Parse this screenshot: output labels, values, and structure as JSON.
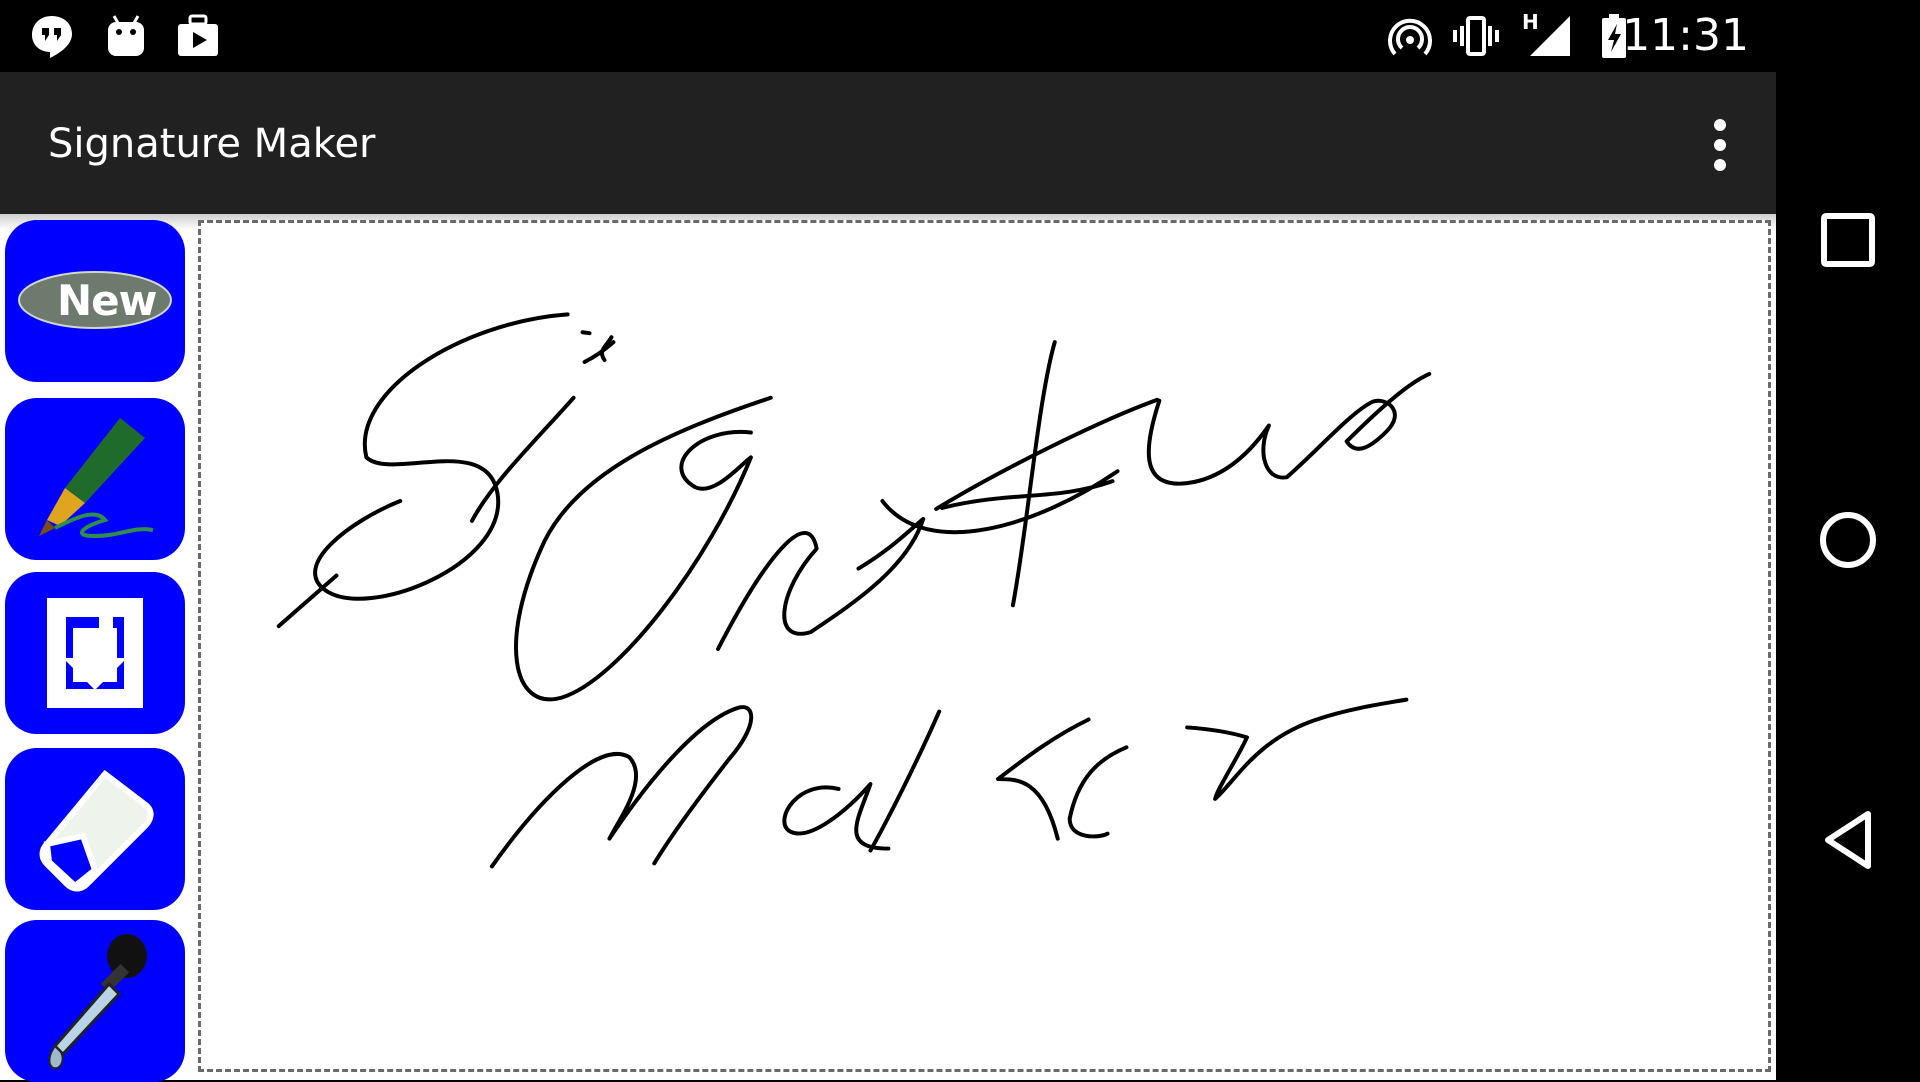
{
  "status_bar": {
    "time": "11:31",
    "network_type": "H",
    "left_icons": [
      "hangouts-icon",
      "android-debug-icon",
      "play-store-icon"
    ],
    "right_icons": [
      "hotspot-icon",
      "vibrate-icon",
      "signal-icon",
      "battery-charging-icon"
    ]
  },
  "action_bar": {
    "title": "Signature Maker",
    "overflow_icon": "more-vert-icon"
  },
  "toolbar": {
    "new_label": "New",
    "tools": [
      "new-icon",
      "pen-icon",
      "save-icon",
      "eraser-icon",
      "dropper-icon"
    ]
  },
  "canvas": {
    "signature_text": "Signature Maker"
  },
  "nav_bar": {
    "buttons": [
      "recents-icon",
      "home-icon",
      "back-icon"
    ]
  },
  "colors": {
    "status_bar": "#000000",
    "action_bar": "#212121",
    "tool_button": "#0000ff",
    "canvas_border": "#6a6a6a",
    "ink": "#000000"
  }
}
